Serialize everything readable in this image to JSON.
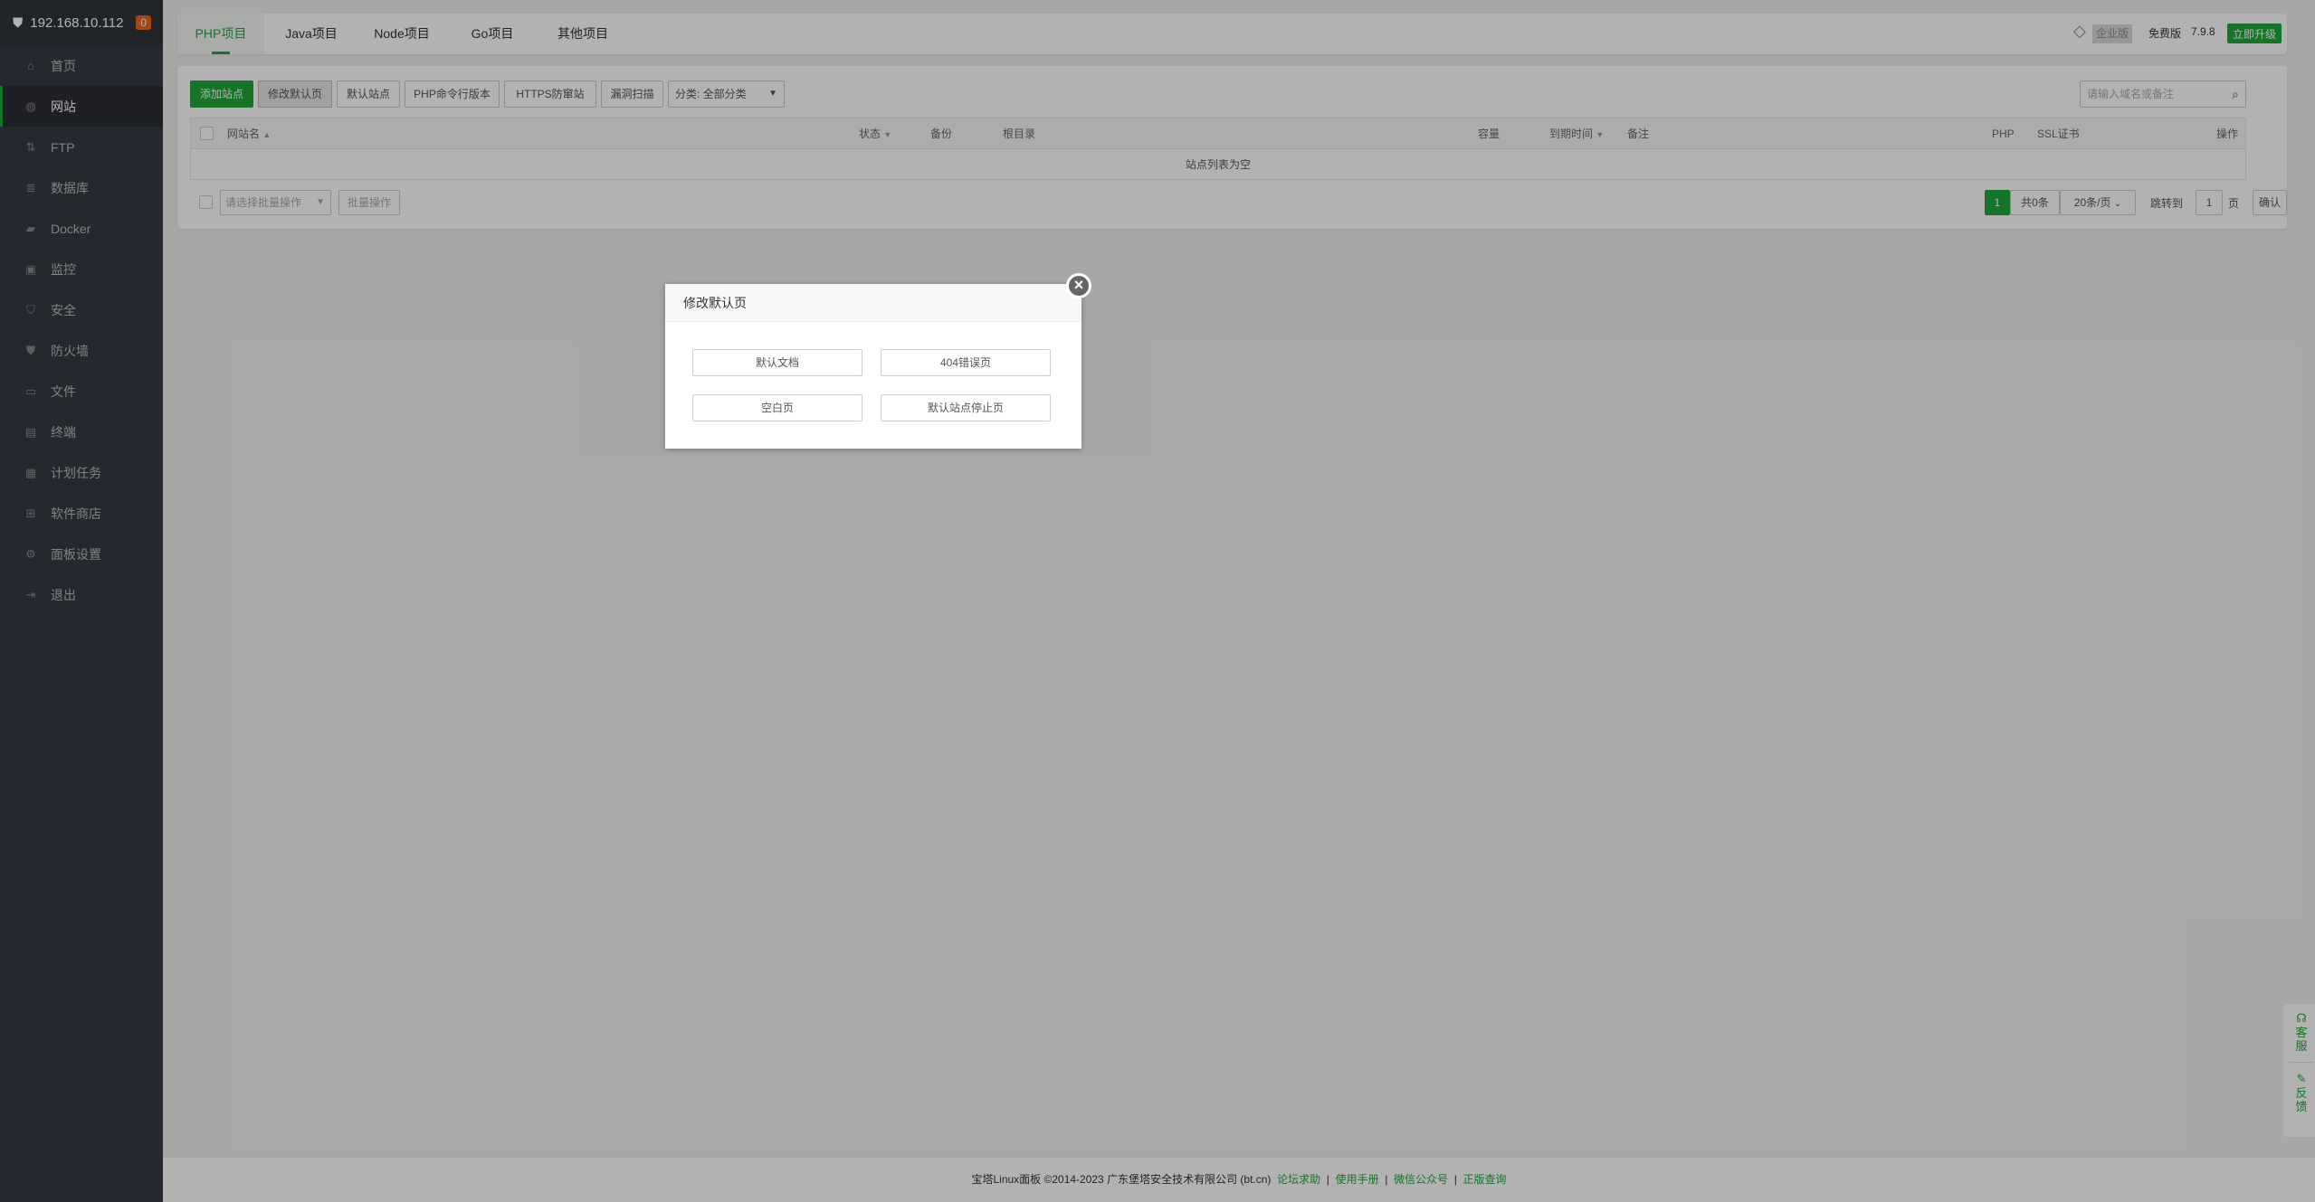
{
  "sidebar": {
    "host": "192.168.10.112",
    "badge": "0",
    "items": [
      {
        "label": "首页",
        "icon": "home-icon"
      },
      {
        "label": "网站",
        "icon": "globe-icon"
      },
      {
        "label": "FTP",
        "icon": "ftp-icon"
      },
      {
        "label": "数据库",
        "icon": "database-icon"
      },
      {
        "label": "Docker",
        "icon": "docker-icon"
      },
      {
        "label": "监控",
        "icon": "monitor-icon"
      },
      {
        "label": "安全",
        "icon": "shield-icon"
      },
      {
        "label": "防火墙",
        "icon": "firewall-icon"
      },
      {
        "label": "文件",
        "icon": "folder-icon"
      },
      {
        "label": "终端",
        "icon": "terminal-icon"
      },
      {
        "label": "计划任务",
        "icon": "calendar-icon"
      },
      {
        "label": "软件商店",
        "icon": "grid-icon"
      },
      {
        "label": "面板设置",
        "icon": "gear-icon"
      },
      {
        "label": "退出",
        "icon": "logout-icon"
      }
    ]
  },
  "tabs": [
    "PHP项目",
    "Java项目",
    "Node项目",
    "Go项目",
    "其他项目"
  ],
  "header": {
    "enterprise": "企业版",
    "edition": "免费版",
    "version": "7.9.8",
    "upgrade": "立即升级"
  },
  "toolbar": {
    "buttons": [
      "添加站点",
      "修改默认页",
      "默认站点",
      "PHP命令行版本",
      "HTTPS防窜站",
      "漏洞扫描"
    ],
    "category": "分类: 全部分类",
    "search_placeholder": "请输入域名或备注"
  },
  "table": {
    "columns": [
      "网站名",
      "状态",
      "备份",
      "根目录",
      "容量",
      "到期时间",
      "备注",
      "PHP",
      "SSL证书",
      "操作"
    ],
    "empty": "站点列表为空"
  },
  "batch": {
    "select_placeholder": "请选择批量操作",
    "button": "批量操作"
  },
  "pagination": {
    "current": "1",
    "total": "共0条",
    "per_page": "20条/页",
    "jump_label": "跳转到",
    "page_input": "1",
    "page_unit": "页",
    "confirm": "确认"
  },
  "dialog": {
    "title": "修改默认页",
    "buttons": [
      "默认文档",
      "404错误页",
      "空白页",
      "默认站点停止页"
    ]
  },
  "footer": {
    "copyright": "宝塔Linux面板 ©2014-2023 广东堡塔安全技术有限公司 (bt.cn)",
    "links": [
      "论坛求助",
      "使用手册",
      "微信公众号",
      "正版查询"
    ]
  },
  "float": {
    "service": "客服",
    "feedback": "反馈"
  }
}
